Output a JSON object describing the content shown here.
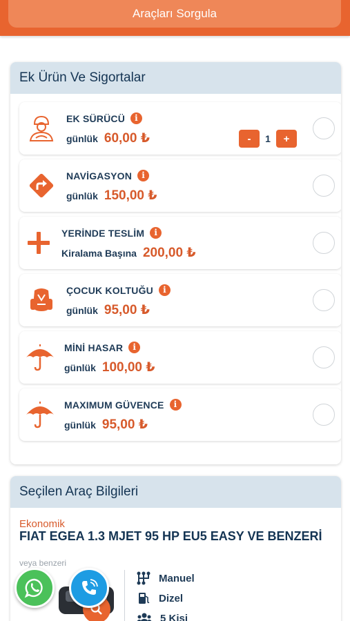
{
  "header": {
    "query_button": "Araçları Sorgula"
  },
  "extras": {
    "title": "Ek Ürün Ve Sigortalar",
    "items": [
      {
        "title": "EK SÜRÜCÜ",
        "unit": "günlük",
        "price": "60,00 ₺",
        "icon": "driver-icon",
        "quantity": "1",
        "minus": "-",
        "plus": "+"
      },
      {
        "title": "NAVİGASYON",
        "unit": "günlük",
        "price": "150,00 ₺",
        "icon": "navigation-icon"
      },
      {
        "title": "YERİNDE TESLİM",
        "unit": "Kiralama Başına",
        "price": "200,00 ₺",
        "icon": "plus-icon"
      },
      {
        "title": "ÇOCUK KOLTUĞU",
        "unit": "günlük",
        "price": "95,00 ₺",
        "icon": "child-seat-icon"
      },
      {
        "title": "MİNİ HASAR",
        "unit": "günlük",
        "price": "100,00 ₺",
        "icon": "umbrella-icon"
      },
      {
        "title": "MAXIMUM GÜVENCE",
        "unit": "günlük",
        "price": "95,00 ₺",
        "icon": "umbrella-icon"
      }
    ],
    "info_glyph": "i"
  },
  "vehicle": {
    "title": "Seçilen Araç Bilgileri",
    "class": "Ekonomik",
    "name": "FIAT EGEA 1.3 MJET 95 HP EU5 EASY VE BENZERİ",
    "subtitle": "veya benzeri",
    "features": [
      {
        "label": "Manuel",
        "icon": "gearbox-icon"
      },
      {
        "label": "Dizel",
        "icon": "fuel-icon"
      },
      {
        "label": "5 Kişi",
        "icon": "people-icon"
      }
    ]
  },
  "colors": {
    "accent": "#e8642f",
    "header_bg": "#d7e3ec",
    "text": "#1f3b57",
    "whatsapp": "#4bc15a",
    "call": "#1e9ce3"
  }
}
